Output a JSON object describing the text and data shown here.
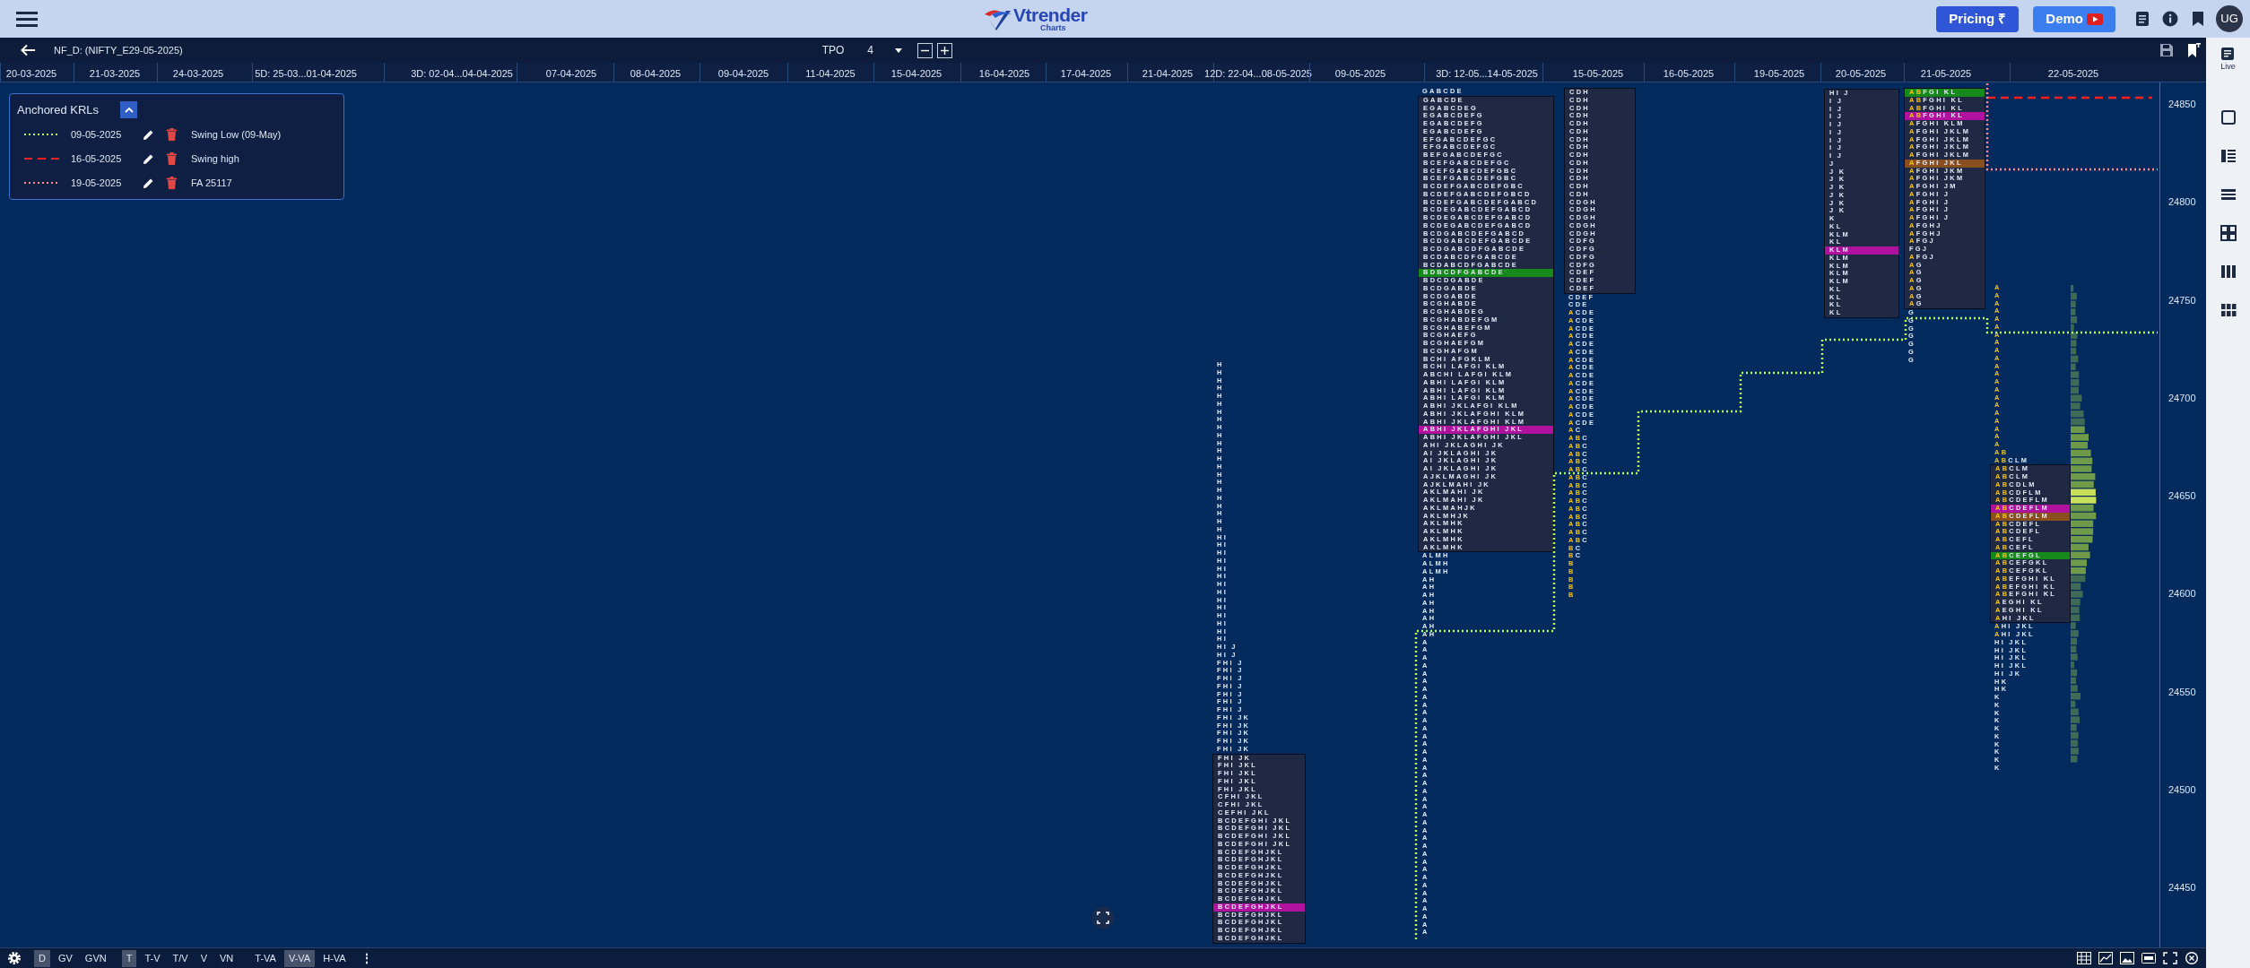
{
  "header": {
    "logo_text": "Vtrender",
    "logo_subtext": "Charts",
    "buttons": [
      {
        "label": "Pricing ₹",
        "kind": "pricing"
      },
      {
        "label": "Demo",
        "kind": "demo"
      }
    ],
    "avatar": "UG"
  },
  "toolbar": {
    "symbol": "NF_D: (NIFTY_E29-05-2025)",
    "chart_type": "TPO",
    "tpo_size": "4"
  },
  "dates": [
    "20-03-2025",
    "21-03-2025",
    "24-03-2025",
    "5D: 25-03...01-04-2025",
    "3D: 02-04...04-04-2025",
    "07-04-2025",
    "08-04-2025",
    "09-04-2025",
    "11-04-2025",
    "15-04-2025",
    "16-04-2025",
    "17-04-2025",
    "21-04-2025",
    "12D: 22-04...08-05-2025",
    "09-05-2025",
    "3D: 12-05...14-05-2025",
    "15-05-2025",
    "16-05-2025",
    "19-05-2025",
    "20-05-2025",
    "21-05-2025",
    "22-05-2025"
  ],
  "krl_panel": {
    "title": "Anchored KRLs",
    "expanded": true,
    "items": [
      {
        "date": "09-05-2025",
        "name": "Swing Low (09-May)",
        "color": "#b4ff5c",
        "kind": "dotted"
      },
      {
        "date": "16-05-2025",
        "name": "Swing high",
        "color": "#ff1f1f",
        "kind": "dashed"
      },
      {
        "date": "19-05-2025",
        "name": "FA 25117",
        "color": "#ff8c8c",
        "kind": "dotted"
      }
    ]
  },
  "price_axis": [
    "24850",
    "24800",
    "24750",
    "24700",
    "24650",
    "24600",
    "24550",
    "24500",
    "24450"
  ],
  "profiles": [
    {
      "above": [
        "H",
        "H",
        "H",
        "H",
        "H",
        "H",
        "H",
        "H",
        "H",
        "H",
        "H",
        "H",
        "H",
        "H",
        "H",
        "H",
        "H",
        "H",
        "H",
        "H",
        "H",
        "H",
        "HI",
        "HI",
        "HI",
        "HI",
        "HI",
        "HI",
        "HI",
        "HI",
        "HI",
        "HI",
        "HI",
        "HI",
        "HI",
        "HI",
        "HI J",
        "HI J",
        "FHI J",
        "FHI J",
        "FHI J",
        "FHI J",
        "FHI J",
        "FHI J",
        "FHI J",
        "FHI JK",
        "FHI JK",
        "FHI JK",
        "FHI JK",
        "FHI JK"
      ],
      "value_area": [
        "FHI JK",
        "FHI JKL",
        "FHI JKL",
        "FHI JKL",
        "FHI JKL",
        "CFHI JKL",
        "CFHI JKL",
        "CEFHI JKL",
        "BCDEFGHI JKL",
        "BCDEFGHI JKL",
        "BCDEFGHI JKL",
        "BCDEFGHI JKL",
        "BCDEFGHJKL",
        "BCDEFGHJKL",
        "BCDEFGHJKL",
        "BCDEFGHJKL",
        "BCDEFGHJKL",
        "BCDEFGHJKL",
        "BCDEFGHJKL",
        {
          "text": "BCDEFGHJKL",
          "color": "#b0119e"
        },
        "BCDEFGHJKL",
        "BCDEFGHJKL",
        "BCDEFGHJKL",
        "BCDEFGHJKL"
      ]
    },
    {
      "above": [
        "GABCDE"
      ],
      "value_area": [
        "GABCDE",
        "EGABCDEG",
        "EGABCDEFG",
        "EGABCDEFG",
        "EGABCDEFG",
        "EFGABCDEFGC",
        "EFGABCDEFGC",
        "BEFGABCDEFGC",
        "BCEFGABCDEFGC",
        "BCEFGABCDEFGBC",
        "BCEFGABCDEFGBC",
        "BCDEFGABCDEFGBC",
        "BCDEFGABCDEFGBCD",
        "BCDEFGABCDEFGABCD",
        "BCDEGABCDEFGABCD",
        "BCDEGABCDEFGABCD",
        "BCDEGABCDEFGABCD",
        "BCDGABCDEFGABCD",
        "BCDGABCDEFGABCDE",
        "BCDGABCDFGABCDE",
        "BCDABCDFGABCDE",
        "BCDABCDFGABCDE",
        {
          "text": "BDBCDFGABCDE",
          "color": "#15891a"
        },
        "BDCDGABDE",
        "BCDGABDE",
        "BCDGABDE",
        "BCGHABDE",
        "BCGHABDEG",
        "BCGHABDEFGM",
        "BCGHABEFGM",
        "BCGHAEFG",
        "BCGHAEFGM",
        "BCGHAFGM",
        "BCHI AFGKLM",
        "BCHI LAFGI KLM",
        "ABCHI LAFGI KLM",
        "ABHI LAFGI KLM",
        "ABHI LAFGI KLM",
        "ABHI LAFGI KLM",
        "ABHI JKLAFGI KLM",
        "ABHI JKLAFGHI KLM",
        "ABHI JKLAFGHI KLM",
        {
          "text": "ABHI JKLAFGHI JKL",
          "color": "#b0119e"
        },
        "ABHI JKLAFGHI JKL",
        "AHI JKLAGHI JK",
        "AI JKLAGHI JK",
        "AI JKLAGHI JK",
        "AI JKLAGHI JK",
        "AJKLMAGHI JK",
        "AJKLMAHI JK",
        "AKLMAHI JK",
        "AKLMAHI JK",
        "AKLMAHJK",
        "AKLMHJK",
        "AKLMHK",
        "AKLMHK",
        "AKLMHK",
        "AKLMHK"
      ],
      "below": [
        "ALMH",
        "ALMH",
        "ALMH",
        "AH",
        "AH",
        "AH",
        "AH",
        "AH",
        "AH",
        "AH",
        "AH",
        "A",
        "A",
        "A",
        "A",
        "A",
        "A",
        "A",
        "A",
        "A",
        "A",
        "A",
        "A",
        "A",
        "A",
        "A",
        "A",
        "A",
        "A",
        "A",
        "A",
        "A",
        "A",
        "A",
        "A",
        "A",
        "A",
        "A",
        "A",
        "A",
        "A",
        "A",
        "A",
        "A",
        "A",
        "A",
        "A",
        "A",
        "A"
      ]
    },
    {
      "value_area": [
        "CDH",
        "CDH",
        "CDH",
        "CDH",
        "CDH",
        "CDH",
        "CDH",
        "CDH",
        "CDH",
        "CDH",
        "CDH",
        "CDH",
        "CDH",
        "CDH",
        "CDGH",
        "CDGH",
        "CDGH",
        "CDGH",
        "CDGH",
        "CDFG",
        "CDFG",
        "CDFG",
        "CDFG",
        "CDEF",
        "CDEF",
        "CDEF"
      ],
      "below": [
        "CDEF",
        "CDE",
        [
          "A",
          "CDE"
        ],
        [
          "A",
          "CDE"
        ],
        [
          "A",
          "CDE"
        ],
        [
          "A",
          "CDE"
        ],
        [
          "A",
          "CDE"
        ],
        [
          "A",
          "CDE"
        ],
        [
          "A",
          "CDE"
        ],
        [
          "A",
          "CDE"
        ],
        [
          "A",
          "CDE"
        ],
        [
          "A",
          "CDE"
        ],
        [
          "A",
          "CDE"
        ],
        [
          "A",
          "CDE"
        ],
        [
          "A",
          "CDE"
        ],
        [
          "A",
          "CDE"
        ],
        [
          "A",
          "CDE"
        ],
        [
          "A",
          "C"
        ],
        [
          "AB",
          "C"
        ],
        [
          "AB",
          "C"
        ],
        [
          "AB",
          "C"
        ],
        [
          "AB",
          "C"
        ],
        [
          "AB",
          "C"
        ],
        [
          "AB",
          "C"
        ],
        [
          "AB",
          "C"
        ],
        [
          "AB",
          "C"
        ],
        [
          "AB",
          "C"
        ],
        [
          "AB",
          "C"
        ],
        [
          "AB",
          "C"
        ],
        [
          "AB",
          "C"
        ],
        [
          "AB",
          "C"
        ],
        [
          "AB",
          "C"
        ],
        [
          "B",
          "C"
        ],
        [
          "B",
          "C"
        ],
        [
          "B"
        ],
        [
          "B"
        ],
        [
          "B"
        ],
        [
          "B"
        ],
        [
          "B"
        ]
      ]
    },
    {
      "value_area": [
        "HI J",
        "I J",
        "I J",
        "I J",
        "I J",
        "I J",
        "I J",
        "I J",
        "I J",
        "J",
        "J K",
        "J K",
        "J K",
        "J K",
        "J K",
        "J K",
        "K",
        "KL",
        "KLM",
        "KL",
        {
          "text": "KLM",
          "color": "#b0119e"
        },
        "KLM",
        "KLM",
        "KLM",
        "KLM",
        "KL",
        "KL",
        "KL",
        "KL"
      ]
    },
    {
      "value_area": [
        {
          "ib": "AB",
          "text": "FGI KL",
          "color": "#15891a"
        },
        [
          "AB",
          "FGHI KL"
        ],
        [
          "AB",
          "FGHI KL"
        ],
        {
          "ib": "AB",
          "text": "FGHI KL",
          "color": "#b0119e"
        },
        [
          "A",
          "FGHI KLM"
        ],
        [
          "A",
          "FGHI JKLM"
        ],
        [
          "A",
          "FGHI JKLM"
        ],
        [
          "A",
          "FGHI JKLM"
        ],
        [
          "A",
          "FGHI JKLM"
        ],
        {
          "ib": "A",
          "text": "FGHI JKL",
          "color": "#8a4f1e"
        },
        [
          "A",
          "FGHI JKM"
        ],
        [
          "A",
          "FGHI JKM"
        ],
        [
          "A",
          "FGHI JM"
        ],
        [
          "A",
          "FGHI J"
        ],
        [
          "A",
          "FGHI J"
        ],
        [
          "A",
          "FGHI J"
        ],
        [
          "A",
          "FGHI J"
        ],
        [
          "A",
          "FGHJ"
        ],
        [
          "A",
          "FGHJ"
        ],
        [
          "A",
          "FGJ"
        ],
        "FGJ",
        [
          "A",
          "FGJ"
        ],
        [
          "A",
          "G"
        ],
        [
          "A",
          "G"
        ],
        [
          "A",
          "G"
        ],
        [
          "A",
          "G"
        ],
        [
          "A",
          "G"
        ],
        [
          "A",
          "G"
        ]
      ],
      "below": [
        "G",
        "G",
        "G",
        "G",
        "G",
        "G",
        "G"
      ]
    },
    {
      "above": [
        [
          "A"
        ],
        [
          "A"
        ],
        [
          "A"
        ],
        [
          "A"
        ],
        [
          "A"
        ],
        [
          "A"
        ],
        [
          "A"
        ],
        [
          "A"
        ],
        [
          "A"
        ],
        [
          "A"
        ],
        [
          "A"
        ],
        [
          "A"
        ],
        [
          "A"
        ],
        [
          "A"
        ],
        [
          "A"
        ],
        [
          "A"
        ],
        [
          "A"
        ],
        [
          "A"
        ],
        [
          "A"
        ],
        [
          "A"
        ],
        [
          "A"
        ],
        [
          "AB"
        ],
        [
          "AB",
          "CLM"
        ]
      ],
      "value_area": [
        [
          "AB",
          "CLM"
        ],
        [
          "AB",
          "CLM"
        ],
        [
          "AB",
          "CDLM"
        ],
        [
          "AB",
          "CDFLM"
        ],
        [
          "AB",
          "CDEFLM"
        ],
        {
          "ib": "AB",
          "text": "CDEFLM",
          "color": "#b0119e"
        },
        {
          "ib": "AB",
          "text": "CDEFLM",
          "color": "#8a4f1e"
        },
        [
          "AB",
          "CDEFL"
        ],
        [
          "AB",
          "CDEFL"
        ],
        [
          "AB",
          "CEFL"
        ],
        [
          "AB",
          "CEFL"
        ],
        {
          "ib": "AB",
          "text": "CEFGL",
          "color": "#15891a"
        },
        [
          "AB",
          "CEFGKL"
        ],
        [
          "AB",
          "CEFGKL"
        ],
        [
          "AB",
          "EFGHI KL"
        ],
        [
          "AB",
          "EFGHI KL"
        ],
        [
          "AB",
          "EFGHI KL"
        ],
        [
          "A",
          "EGHI KL"
        ],
        [
          "A",
          "EGHI KL"
        ],
        [
          "A",
          "HI JKL"
        ]
      ],
      "below": [
        [
          "A",
          "HI JKL"
        ],
        [
          "A",
          "HI JKL"
        ],
        "HI JKL",
        "HI JKL",
        "HI JKL",
        "HI JKL",
        "HI JK",
        "HK",
        "HK",
        "K",
        "K",
        "K",
        "K",
        "K",
        "K",
        "K",
        "K",
        "K",
        "K"
      ]
    }
  ],
  "bottom_bar": {
    "views": [
      {
        "label": "D",
        "selected": true
      },
      {
        "label": "GV",
        "selected": false
      },
      {
        "label": "GVN",
        "selected": false
      }
    ],
    "modes": [
      {
        "label": "T",
        "selected": true
      },
      {
        "label": "T-V",
        "selected": false
      },
      {
        "label": "T/V",
        "selected": false
      },
      {
        "label": "V",
        "selected": false
      },
      {
        "label": "VN",
        "selected": false
      }
    ],
    "va_modes": [
      {
        "label": "T-VA",
        "selected": false
      },
      {
        "label": "V-VA",
        "selected": true
      },
      {
        "label": "H-VA",
        "selected": false
      }
    ],
    "more": "⋮"
  },
  "sidebar": {
    "live_label": "Live"
  }
}
